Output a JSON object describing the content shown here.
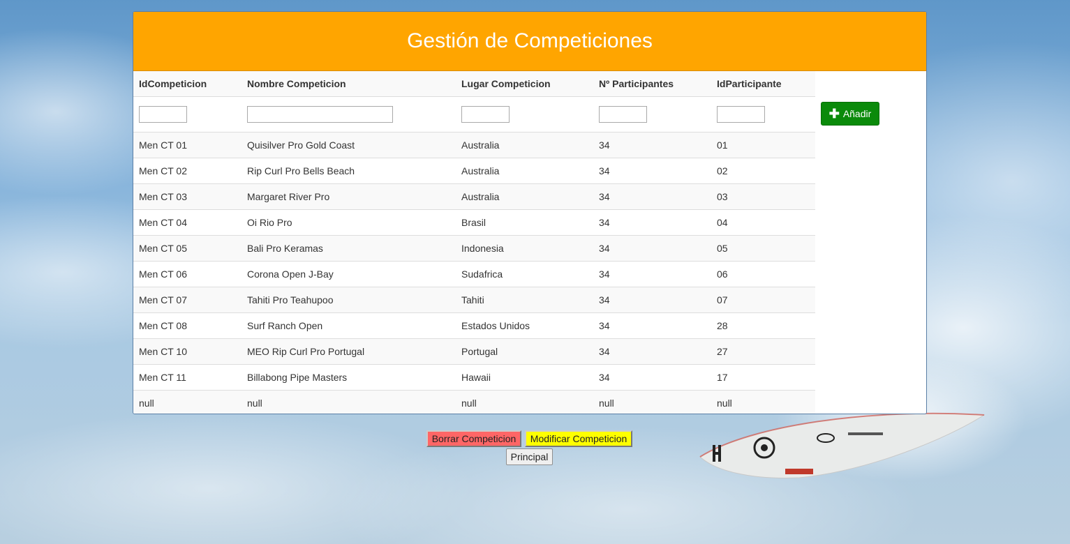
{
  "header": {
    "title": "Gestión de Competiciones"
  },
  "table": {
    "columns": [
      "IdCompeticion",
      "Nombre Competicion",
      "Lugar Competicion",
      "Nº Participantes",
      "IdParticipante"
    ],
    "rows": [
      [
        "Men CT 01",
        "Quisilver Pro Gold Coast",
        "Australia",
        "34",
        "01"
      ],
      [
        "Men CT 02",
        "Rip Curl Pro Bells Beach",
        "Australia",
        "34",
        "02"
      ],
      [
        "Men CT 03",
        "Margaret River Pro",
        "Australia",
        "34",
        "03"
      ],
      [
        "Men CT 04",
        "Oi Rio Pro",
        "Brasil",
        "34",
        "04"
      ],
      [
        "Men CT 05",
        "Bali Pro Keramas",
        "Indonesia",
        "34",
        "05"
      ],
      [
        "Men CT 06",
        "Corona Open J-Bay",
        "Sudafrica",
        "34",
        "06"
      ],
      [
        "Men CT 07",
        "Tahiti Pro Teahupoo",
        "Tahiti",
        "34",
        "07"
      ],
      [
        "Men CT 08",
        "Surf Ranch Open",
        "Estados Unidos",
        "34",
        "28"
      ],
      [
        "Men CT 10",
        "MEO Rip Curl Pro Portugal",
        "Portugal",
        "34",
        "27"
      ],
      [
        "Men CT 11",
        "Billabong Pipe Masters",
        "Hawaii",
        "34",
        "17"
      ],
      [
        "null",
        "null",
        "null",
        "null",
        "null"
      ]
    ]
  },
  "filters": {
    "idcompeticion": "",
    "nombre": "",
    "lugar": "",
    "participantes": "",
    "idparticipante": ""
  },
  "add_button": {
    "label": "Añadir",
    "icon": "plus-icon",
    "color": "#0a8a0a"
  },
  "actions": {
    "delete_label": "Borrar Competicion",
    "modify_label": "Modificar Competicion",
    "home_label": "Principal"
  },
  "colors": {
    "header": "#ffa500",
    "delete": "#ff6666",
    "modify": "#ffff00"
  }
}
